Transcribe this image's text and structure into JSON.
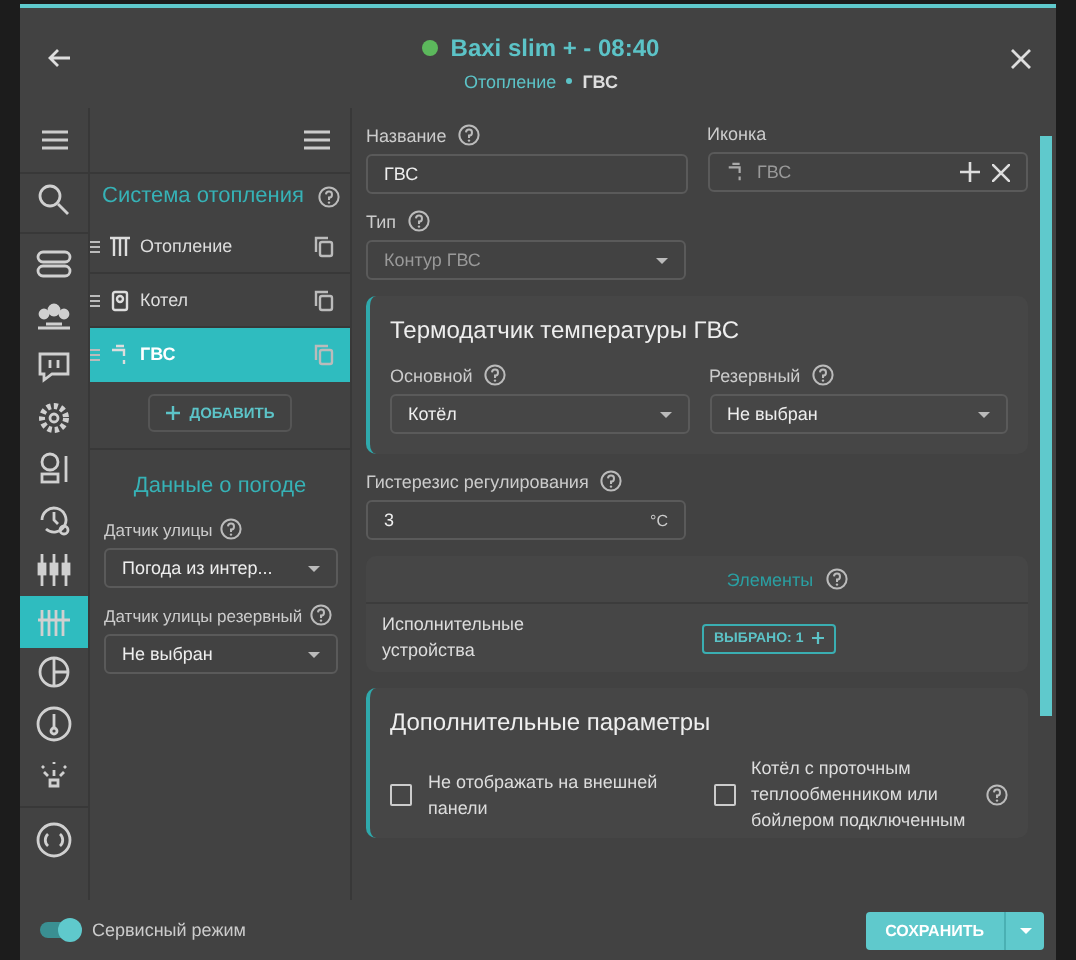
{
  "header": {
    "online": true,
    "title": "Baxi slim + - 08:40",
    "breadcrumb": [
      {
        "label": "Отопление",
        "current": false
      },
      {
        "label": "ГВС",
        "current": true
      }
    ]
  },
  "rail": [
    {
      "kind": "controller",
      "selected": false
    },
    {
      "kind": "people",
      "selected": false
    },
    {
      "kind": "alert",
      "selected": false
    },
    {
      "kind": "gear",
      "selected": false
    },
    {
      "kind": "boiler",
      "selected": false
    },
    {
      "kind": "history",
      "selected": false
    },
    {
      "kind": "sliders",
      "selected": false
    },
    {
      "kind": "radiator",
      "selected": true
    },
    {
      "kind": "pie",
      "selected": false
    },
    {
      "kind": "thermometer",
      "selected": false
    },
    {
      "kind": "sparkle",
      "selected": false
    }
  ],
  "rail_bottom": [
    {
      "kind": "radio",
      "selected": false
    }
  ],
  "system": {
    "title": "Система отопления",
    "circuits": [
      {
        "kind": "radiator",
        "label": "Отопление",
        "selected": false
      },
      {
        "kind": "boiler",
        "label": "Котел",
        "selected": false
      },
      {
        "kind": "tap",
        "label": "ГВС",
        "selected": true
      }
    ],
    "add_button": "ДОБАВИТЬ"
  },
  "weather": {
    "title": "Данные о погоде",
    "fields": [
      {
        "label": "Датчик улицы",
        "value": "Погода из интер..."
      },
      {
        "label": "Датчик улицы резервный",
        "value": "Не выбран"
      }
    ]
  },
  "form": {
    "name": {
      "label": "Название",
      "value": "ГВС"
    },
    "icon": {
      "label": "Иконка",
      "value": "ГВС"
    },
    "type": {
      "label": "Тип",
      "value": "Контур ГВС",
      "disabled": true
    },
    "sensor": {
      "title": "Термодатчик температуры ГВС",
      "selects": [
        {
          "label": "Основной",
          "value": "Котёл"
        },
        {
          "label": "Резервный",
          "value": "Не выбран"
        }
      ]
    },
    "hysteresis": {
      "label": "Гистерезис регулирования",
      "value": "3",
      "unit": "°C"
    },
    "elements": {
      "title": "Элементы",
      "row_label": "Исполнительные устройства",
      "button": "ВЫБРАНО: 1"
    },
    "extra": {
      "title": "Дополнительные параметры",
      "options": [
        {
          "label": "Не отображать на внешней панели",
          "checked": false,
          "help": false
        },
        {
          "label": "Котёл с проточным теплообменником или бойлером подключенным",
          "checked": false,
          "help": true
        }
      ]
    }
  },
  "footer": {
    "service_mode": {
      "label": "Сервисный режим",
      "on": true
    },
    "save": "СОХРАНИТЬ"
  }
}
